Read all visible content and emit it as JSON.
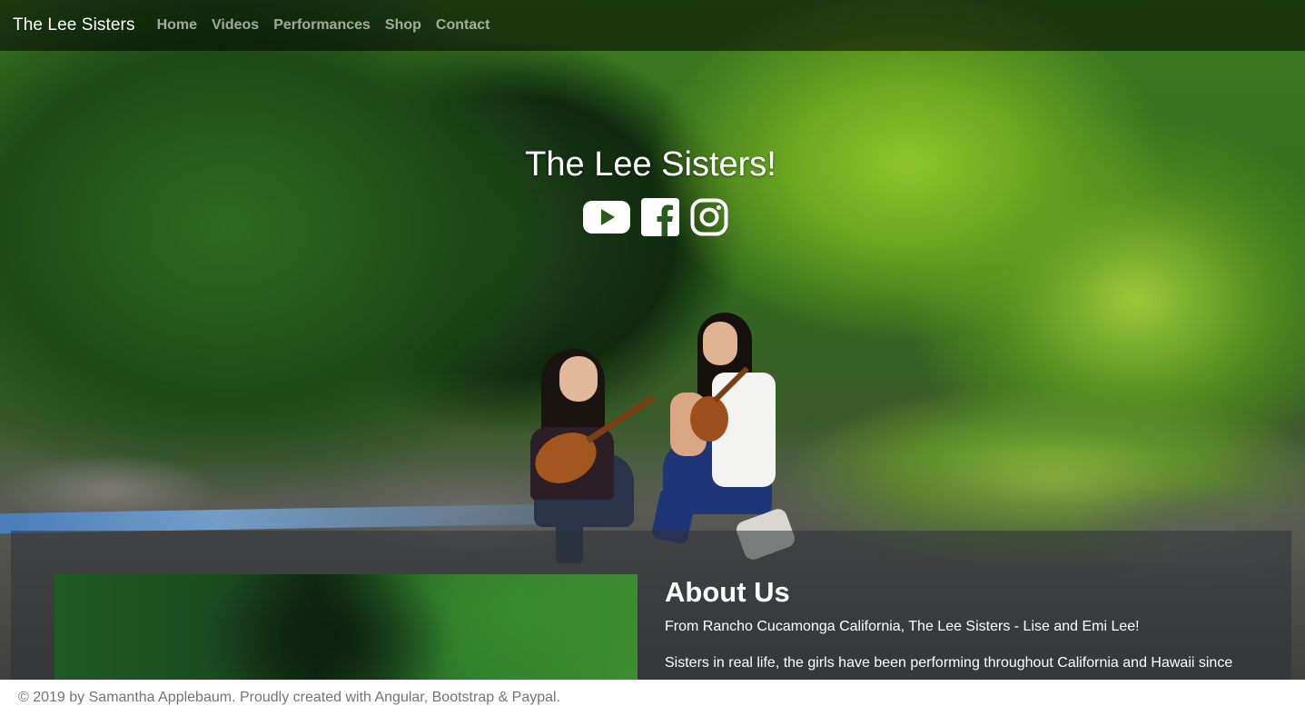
{
  "navbar": {
    "brand": "The Lee Sisters",
    "links": [
      "Home",
      "Videos",
      "Performances",
      "Shop",
      "Contact"
    ]
  },
  "hero": {
    "title": "The Lee Sisters!",
    "social_icons": [
      "youtube-icon",
      "facebook-icon",
      "instagram-icon"
    ]
  },
  "about": {
    "title": "About Us",
    "line1": "From Rancho Cucamonga California, The Lee Sisters - Lise and Emi Lee!",
    "line2": "Sisters in real life, the girls have been performing throughout California and Hawaii since"
  },
  "footer": {
    "text": "© 2019 by Samantha Applebaum. Proudly created with Angular, Bootstrap & Paypal."
  },
  "colors": {
    "navbar_bg": "#000000",
    "nav_link": "#a6a6a6",
    "footer_text": "#6c757d"
  }
}
